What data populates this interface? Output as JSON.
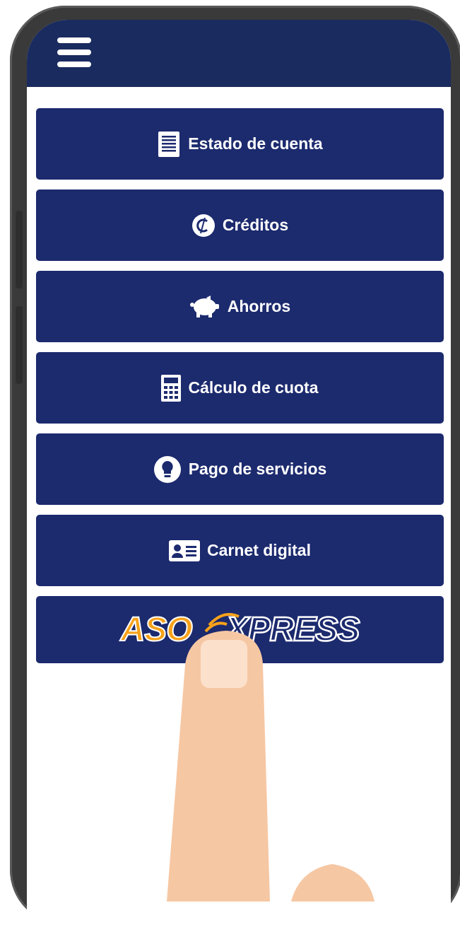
{
  "menu": {
    "items": [
      {
        "label": "Estado de cuenta",
        "icon": "document-icon"
      },
      {
        "label": "Créditos",
        "icon": "colon-coin-icon"
      },
      {
        "label": "Ahorros",
        "icon": "piggy-bank-icon"
      },
      {
        "label": "Cálculo de cuota",
        "icon": "calculator-icon"
      },
      {
        "label": "Pago de servicios",
        "icon": "lightbulb-icon"
      },
      {
        "label": "Carnet digital",
        "icon": "id-card-icon"
      }
    ]
  },
  "asoexpress": {
    "logo_left": "ASO",
    "logo_right": "XPRESS"
  },
  "colors": {
    "appbar": "#1a2b5f",
    "button": "#1c2a6e",
    "logo_accent": "#f7a21b",
    "skin": "#f6c7a3"
  }
}
